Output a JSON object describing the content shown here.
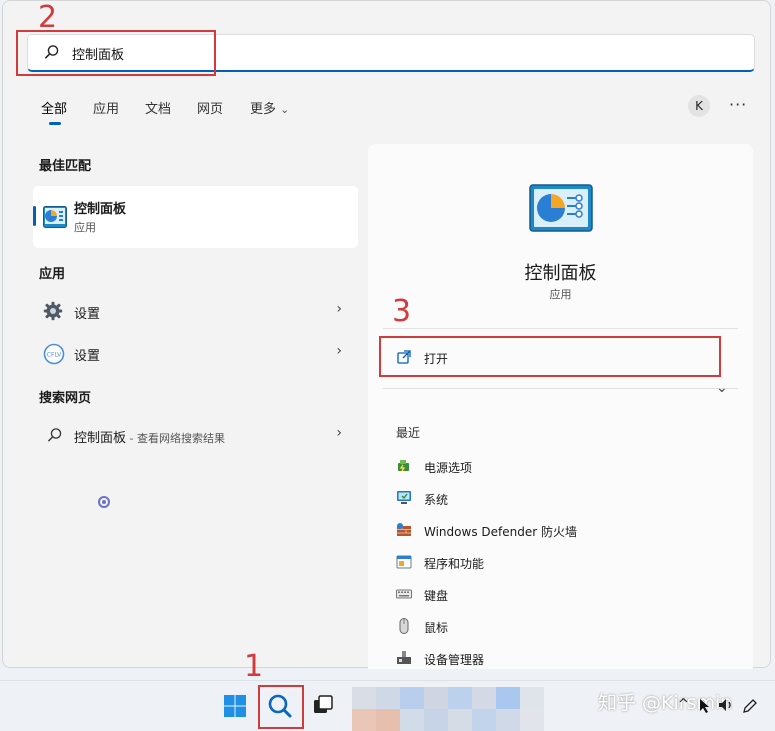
{
  "search": {
    "value": "控制面板"
  },
  "tabs": [
    {
      "label": "全部",
      "active": true
    },
    {
      "label": "应用"
    },
    {
      "label": "文档"
    },
    {
      "label": "网页"
    },
    {
      "label": "更多"
    }
  ],
  "more_chevron": "⌄",
  "avatar_letter": "K",
  "ellipsis": "···",
  "best_match": {
    "section": "最佳匹配",
    "title": "控制面板",
    "subtitle": "应用"
  },
  "apps": {
    "section": "应用",
    "items": [
      {
        "label": "设置",
        "icon": "gear-icon"
      },
      {
        "label": "设置",
        "icon": "cflv-icon"
      }
    ]
  },
  "web": {
    "section": "搜索网页",
    "query": "控制面板",
    "suffix": " - 查看网络搜索结果"
  },
  "preview": {
    "title": "控制面板",
    "subtitle": "应用",
    "open_label": "打开",
    "recent_title": "最近",
    "recent": [
      {
        "label": "电源选项",
        "icon": "power-options-icon"
      },
      {
        "label": "系统",
        "icon": "system-icon"
      },
      {
        "label": "Windows Defender 防火墙",
        "icon": "firewall-icon"
      },
      {
        "label": "程序和功能",
        "icon": "programs-icon"
      },
      {
        "label": "键盘",
        "icon": "keyboard-icon"
      },
      {
        "label": "鼠标",
        "icon": "mouse-icon"
      },
      {
        "label": "设备管理器",
        "icon": "device-manager-icon"
      }
    ]
  },
  "annotations": [
    "1",
    "2",
    "3"
  ],
  "watermark": "知乎 @Kirsmin",
  "tray": {
    "chevron": "^"
  },
  "colors": {
    "accent": "#005fb8",
    "annotation": "#d23b3b"
  }
}
